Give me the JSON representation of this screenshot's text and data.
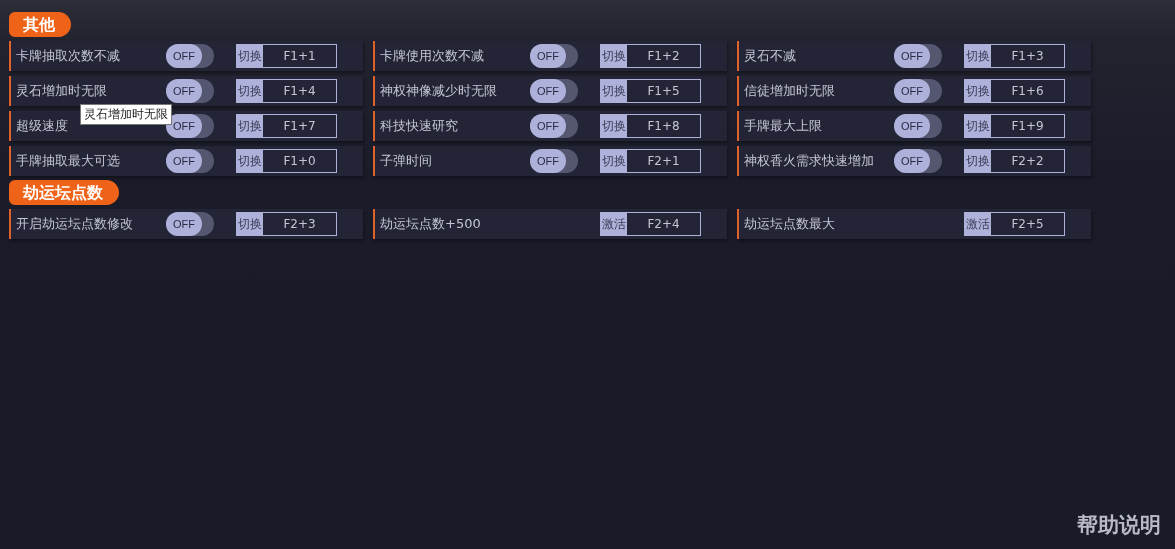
{
  "sections": [
    {
      "title": "其他",
      "items": [
        {
          "kind": "toggle",
          "name": "卡牌抽取次数不减",
          "switch_text": "OFF",
          "on": false,
          "action": "切换",
          "hotkey": "F1+1"
        },
        {
          "kind": "toggle",
          "name": "卡牌使用次数不减",
          "switch_text": "OFF",
          "on": false,
          "action": "切换",
          "hotkey": "F1+2"
        },
        {
          "kind": "toggle",
          "name": "灵石不减",
          "switch_text": "OFF",
          "on": false,
          "action": "切换",
          "hotkey": "F1+3"
        },
        {
          "kind": "toggle",
          "name": "灵石增加时无限",
          "switch_text": "OFF",
          "on": false,
          "action": "切换",
          "hotkey": "F1+4",
          "tooltip": "灵石增加时无限"
        },
        {
          "kind": "toggle",
          "name": "神权神像减少时无限",
          "switch_text": "OFF",
          "on": false,
          "action": "切换",
          "hotkey": "F1+5"
        },
        {
          "kind": "toggle",
          "name": "信徒增加时无限",
          "switch_text": "OFF",
          "on": false,
          "action": "切换",
          "hotkey": "F1+6"
        },
        {
          "kind": "toggle",
          "name": "超级速度",
          "switch_text": "OFF",
          "on": false,
          "action": "切换",
          "hotkey": "F1+7"
        },
        {
          "kind": "toggle",
          "name": "科技快速研究",
          "switch_text": "OFF",
          "on": false,
          "action": "切换",
          "hotkey": "F1+8"
        },
        {
          "kind": "toggle",
          "name": "手牌最大上限",
          "switch_text": "OFF",
          "on": false,
          "action": "切换",
          "hotkey": "F1+9"
        },
        {
          "kind": "toggle",
          "name": "手牌抽取最大可选",
          "switch_text": "OFF",
          "on": false,
          "action": "切换",
          "hotkey": "F1+0"
        },
        {
          "kind": "toggle",
          "name": "子弹时间",
          "switch_text": "OFF",
          "on": false,
          "action": "切换",
          "hotkey": "F2+1"
        },
        {
          "kind": "toggle",
          "name": "神权香火需求快速增加",
          "switch_text": "OFF",
          "on": false,
          "action": "切换",
          "hotkey": "F2+2"
        }
      ]
    },
    {
      "title": "劫运坛点数",
      "items": [
        {
          "kind": "toggle",
          "name": "开启劫运坛点数修改",
          "switch_text": "OFF",
          "on": false,
          "action": "切换",
          "hotkey": "F2+3"
        },
        {
          "kind": "button",
          "name": "劫运坛点数+500",
          "action": "激活",
          "hotkey": "F2+4"
        },
        {
          "kind": "button",
          "name": "劫运坛点数最大",
          "action": "激活",
          "hotkey": "F2+5"
        }
      ]
    }
  ],
  "help": "帮助说明"
}
